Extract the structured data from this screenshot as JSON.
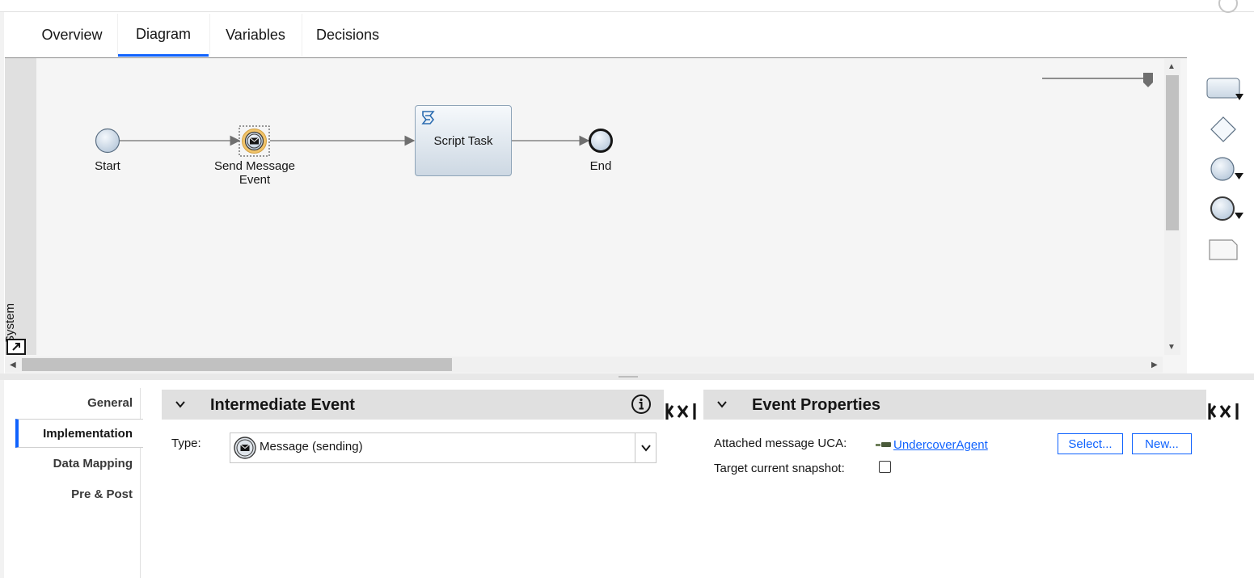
{
  "tabs": [
    {
      "label": "Overview"
    },
    {
      "label": "Diagram"
    },
    {
      "label": "Variables"
    },
    {
      "label": "Decisions"
    }
  ],
  "active_tab": "Diagram",
  "diagram": {
    "lane_label": "System",
    "nodes": {
      "start": "Start",
      "send_message_line1": "Send Message",
      "send_message_line2": "Event",
      "script_task": "Script Task",
      "end": "End"
    }
  },
  "palette": {
    "items": [
      "activity-icon",
      "gateway-icon",
      "start-event-icon",
      "intermediate-event-icon",
      "note-icon"
    ]
  },
  "side_nav": {
    "items": [
      {
        "label": "General"
      },
      {
        "label": "Implementation"
      },
      {
        "label": "Data Mapping"
      },
      {
        "label": "Pre & Post"
      }
    ],
    "active": "Implementation"
  },
  "intermediate_event": {
    "title": "Intermediate Event",
    "type_label": "Type:",
    "type_value": "Message (sending)"
  },
  "event_properties": {
    "title": "Event Properties",
    "attached_label": "Attached message UCA:",
    "attached_value": "UndercoverAgent",
    "select_button": "Select...",
    "new_button": "New...",
    "target_label": "Target current snapshot:",
    "target_checked": false
  },
  "colors": {
    "accent": "#0f62fe",
    "canvas_bg": "#f5f5f5",
    "section_header_bg": "#e0e0e0"
  }
}
